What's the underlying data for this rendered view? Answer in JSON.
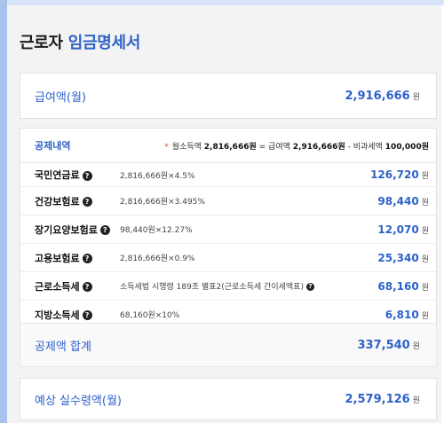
{
  "title": {
    "prefix": "근로자",
    "accent": "임금명세서"
  },
  "gross": {
    "label": "급여액(월)",
    "amount": "2,916,666",
    "unit": "원"
  },
  "deductions": {
    "header_label": "공제내역",
    "note_prefix": "월소득액",
    "note_taxable": "2,816,666원",
    "note_eq": "= 급여액",
    "note_gross": "2,916,666원",
    "note_minus": "- 비과세액",
    "note_nontax": "100,000원",
    "items": [
      {
        "name": "국민연금료",
        "formula": "2,816,666원×4.5%",
        "value": "126,720",
        "unit": "원"
      },
      {
        "name": "건강보험료",
        "formula": "2,816,666원×3.495%",
        "value": "98,440",
        "unit": "원"
      },
      {
        "name": "장기요양보험료",
        "formula": "98,440원×12.27%",
        "value": "12,070",
        "unit": "원"
      },
      {
        "name": "고용보험료",
        "formula": "2,816,666원×0.9%",
        "value": "25,340",
        "unit": "원"
      },
      {
        "name": "근로소득세",
        "formula": "소득세법 시행령 189조 별표2(근로소득세 간이세액표)",
        "value": "68,160",
        "unit": "원"
      },
      {
        "name": "지방소득세",
        "formula": "68,160원×10%",
        "value": "6,810",
        "unit": "원"
      }
    ]
  },
  "total": {
    "label": "공제액 합계",
    "amount": "337,540",
    "unit": "원"
  },
  "net": {
    "label": "예상 실수령액(월)",
    "amount": "2,579,126",
    "unit": "원"
  },
  "icons": {
    "help": "question-circle-icon",
    "star": "asterisk-icon"
  },
  "colors": {
    "accent": "#2e62c9",
    "star": "#e0443a"
  }
}
